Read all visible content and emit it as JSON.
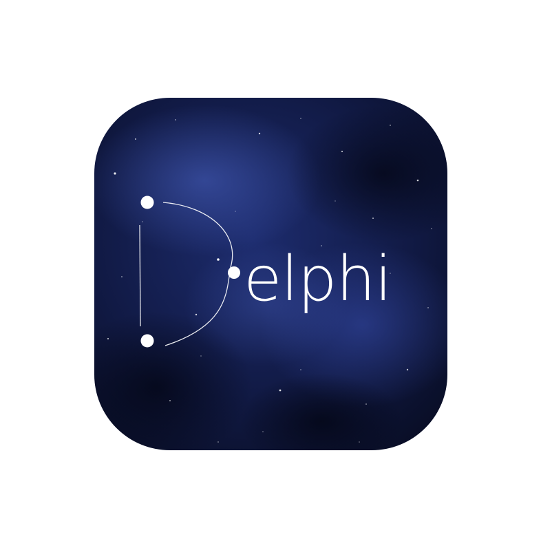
{
  "app_icon": {
    "name": "Delphi",
    "logo_letter_icon": "constellation-letter-d-icon",
    "wordmark_text": "elphi",
    "background_icon": "starfield-nebula",
    "colors": {
      "deep_space": "#0b1230",
      "nebula_blue": "#2a3f8f",
      "nebula_glow": "#3d55b0",
      "star": "#ffffff",
      "line": "#ffffff"
    }
  }
}
